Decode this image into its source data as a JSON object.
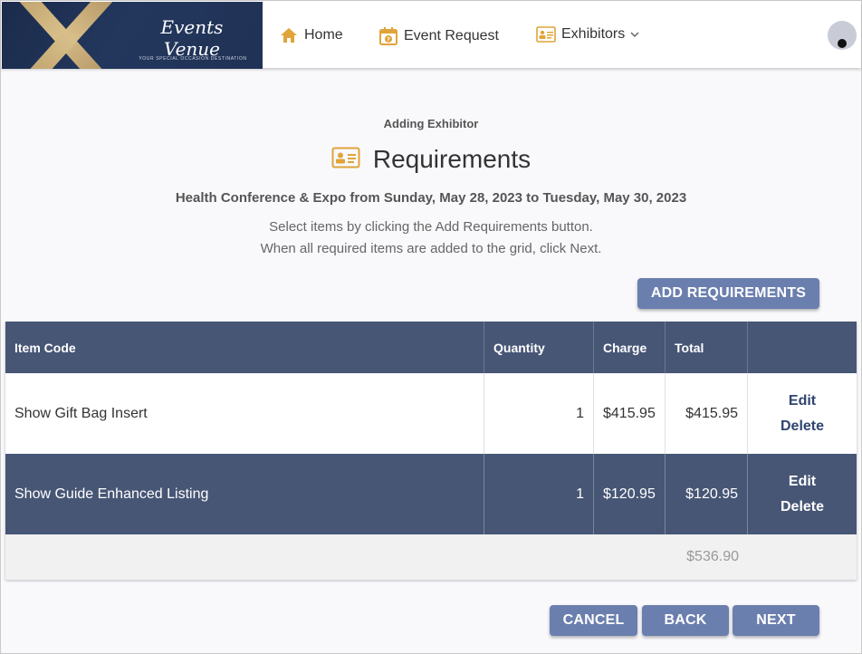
{
  "logo": {
    "title": "Events Venue",
    "subtitle": "YOUR SPECIAL OCCASION DESTINATION"
  },
  "nav": {
    "home": "Home",
    "event_request": "Event Request",
    "exhibitors": "Exhibitors"
  },
  "page": {
    "eyebrow": "Adding Exhibitor",
    "title": "Requirements",
    "event_line": "Health Conference & Expo from Sunday, May 28, 2023 to Tuesday, May 30, 2023",
    "instruction_1": "Select items by clicking the Add Requirements button.",
    "instruction_2": "When all required items are added to the grid, click Next.",
    "add_button": "ADD REQUIREMENTS"
  },
  "grid": {
    "columns": [
      "Item Code",
      "Quantity",
      "Charge",
      "Total",
      ""
    ],
    "rows": [
      {
        "item": "Show Gift Bag Insert",
        "quantity": "1",
        "charge": "$415.95",
        "total": "$415.95",
        "edit": "Edit",
        "delete": "Delete"
      },
      {
        "item": "Show Guide Enhanced Listing",
        "quantity": "1",
        "charge": "$120.95",
        "total": "$120.95",
        "edit": "Edit",
        "delete": "Delete"
      }
    ],
    "grand_total": "$536.90"
  },
  "footer_buttons": {
    "cancel": "CANCEL",
    "back": "BACK",
    "next": "NEXT"
  },
  "colors": {
    "header_row": "#475675",
    "button": "#6b7fae",
    "icon_accent": "#e0a43a"
  },
  "icons": {
    "home": "home-icon",
    "event_request": "calendar-question-icon",
    "exhibitors": "id-card-icon",
    "user": "user-avatar-icon"
  }
}
